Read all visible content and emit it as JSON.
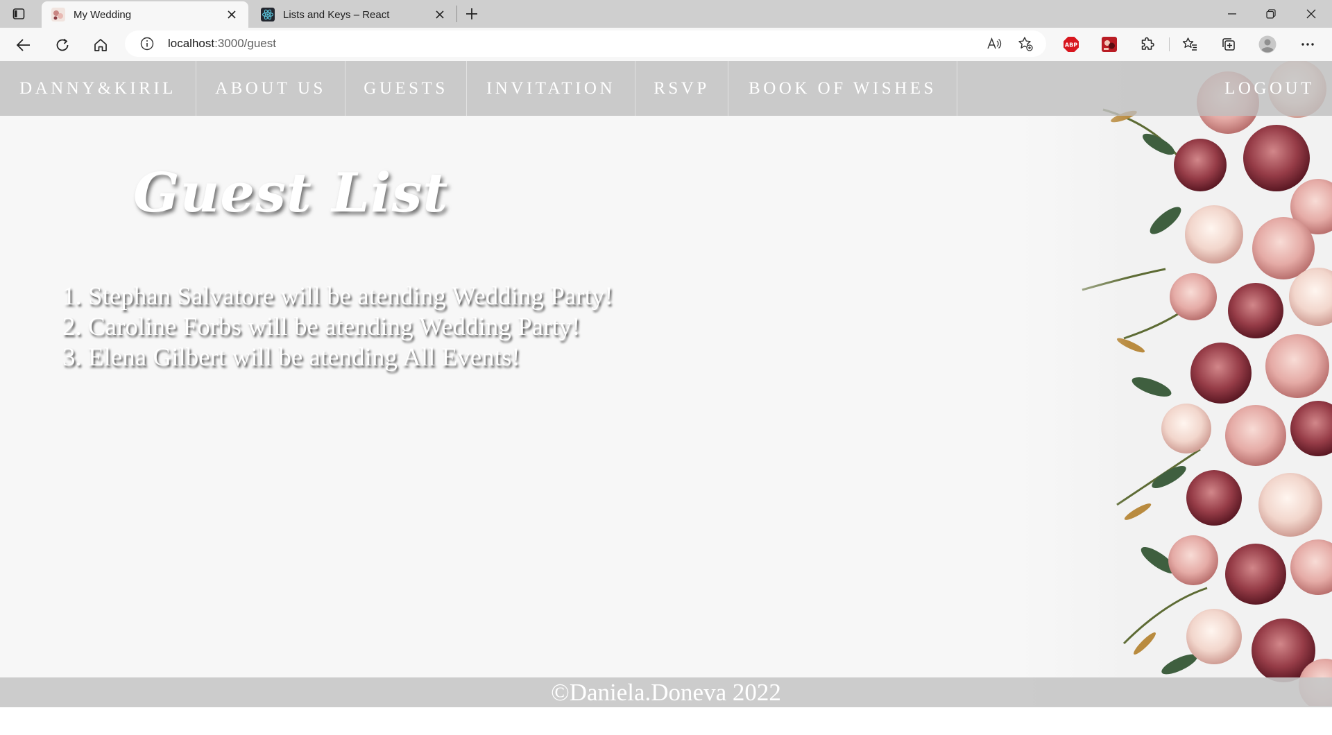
{
  "browser": {
    "tabs": [
      {
        "title": "My Wedding",
        "active": true,
        "favicon": "wedding-favicon"
      },
      {
        "title": "Lists and Keys – React",
        "active": false,
        "favicon": "react-favicon"
      }
    ],
    "address": {
      "host": "localhost",
      "path": ":3000/guest"
    }
  },
  "site": {
    "nav": {
      "brand": "DANNY&KIRIL",
      "items": [
        "ABOUT US",
        "GUESTS",
        "INVITATION",
        "RSVP",
        "BOOK OF WISHES"
      ],
      "logout": "LOGOUT"
    },
    "heading": "Guest List",
    "guests": [
      "1. Stephan Salvatore will be atending Wedding Party!",
      "2. Caroline Forbs will be atending Wedding Party!",
      "3. Elena Gilbert will be atending All Events!"
    ],
    "footer": "©Daniela.Doneva 2022"
  },
  "colors": {
    "nav_bar": "#bebebe",
    "page_bg": "#f7f7f7",
    "text": "#ffffff",
    "abp_red": "#d8161e"
  }
}
